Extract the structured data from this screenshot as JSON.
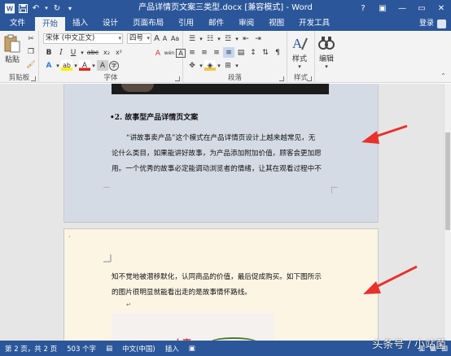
{
  "window": {
    "title": "产品详情页文案三类型.docx [兼容模式] - Word",
    "help": "?",
    "minimize": "—",
    "restore": "▭",
    "close": "✕"
  },
  "qat": {
    "save_icon": "save-icon",
    "undo_icon": "undo-icon",
    "redo_icon": "redo-icon",
    "customize_icon": "customize-icon"
  },
  "tabs": [
    {
      "label": "文件"
    },
    {
      "label": "开始"
    },
    {
      "label": "插入"
    },
    {
      "label": "设计"
    },
    {
      "label": "页面布局"
    },
    {
      "label": "引用"
    },
    {
      "label": "邮件"
    },
    {
      "label": "审阅"
    },
    {
      "label": "视图"
    },
    {
      "label": "开发工具"
    }
  ],
  "user": {
    "login_label": "登录"
  },
  "ribbon": {
    "clipboard": {
      "paste_label": "粘贴",
      "group_label": "剪贴板"
    },
    "font": {
      "font_name": "宋体 (中文正文)",
      "font_size": "四号",
      "group_label": "字体",
      "grow_glyph": "A",
      "shrink_glyph": "A",
      "case_glyph": "Aa",
      "clear_glyph": "A",
      "wen_glyph": "wén",
      "border_glyph": "A",
      "bold": "B",
      "italic": "I",
      "underline": "U",
      "strike": "abc",
      "subscript": "x₂",
      "superscript": "x²",
      "effects_glyph": "A",
      "highlight_glyph": "ab",
      "font_color_glyph": "A",
      "char_shade_glyph": "A",
      "circle_glyph": "字"
    },
    "paragraph": {
      "group_label": "段落"
    },
    "styles": {
      "label": "样式",
      "group_label": "样式"
    },
    "editing": {
      "label": "编辑"
    }
  },
  "document": {
    "heading": "•2.  故事型产品详情页文案",
    "para1_lines": [
      "“讲故事卖产品”这个模式在产品详情页设计上越来越常见，无",
      "论什么类目，如果能讲好故事，为产品添加附加价值，顾客会更加愿",
      "用。一个优秀的故事必定能调动浏览者的情绪，让其在观看过程中不"
    ],
    "para2_lines": [
      "知不觉地被潜移默化，认同商品的价值，最后促成购买。如下图所示",
      "的图片很明显就能看出走的是故事情怀路线。"
    ],
    "photo_text": "太喜"
  },
  "status": {
    "page": "第 2 页，共 2 页",
    "words": "503 个字",
    "lang": "中文(中国)",
    "mode": "插入",
    "zoom": "%"
  },
  "watermark": "头条号 / 小站菌",
  "colors": {
    "accent": "#2b579a",
    "arrow": "#e8312a"
  }
}
